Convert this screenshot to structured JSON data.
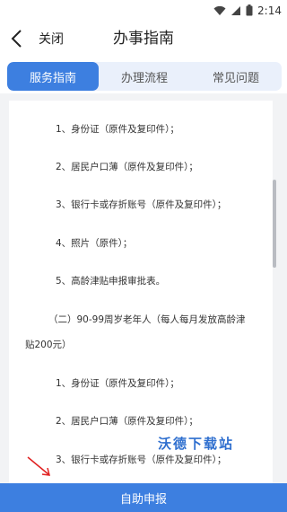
{
  "status_bar": {
    "time": "2:14"
  },
  "nav": {
    "back_label": "关闭",
    "title": "办事指南"
  },
  "tabs": [
    {
      "label": "服务指南",
      "active": true
    },
    {
      "label": "办理流程",
      "active": false
    },
    {
      "label": "常见问题",
      "active": false
    }
  ],
  "content": {
    "lines": [
      "1、身份证（原件及复印件）；",
      "2、居民户口薄（原件及复印件）；",
      "3、银行卡或存折账号（原件及复印件）；",
      "4、照片（原件）；",
      "5、高龄津贴申报审批表。",
      "（二）90-99周岁老年人（每人每月发放高龄津",
      "贴200元）",
      "1、身份证（原件及复印件）；",
      "2、居民户口薄（原件及复印件）；",
      "3、银行卡或存折账号（原件及复印件）；"
    ]
  },
  "watermark": "沃德下载站",
  "apply_button": {
    "label": "自助申报"
  },
  "colors": {
    "primary": "#3d7fe0",
    "tab_bg": "#eaf0fb",
    "content_bg": "#f2f3f5"
  }
}
